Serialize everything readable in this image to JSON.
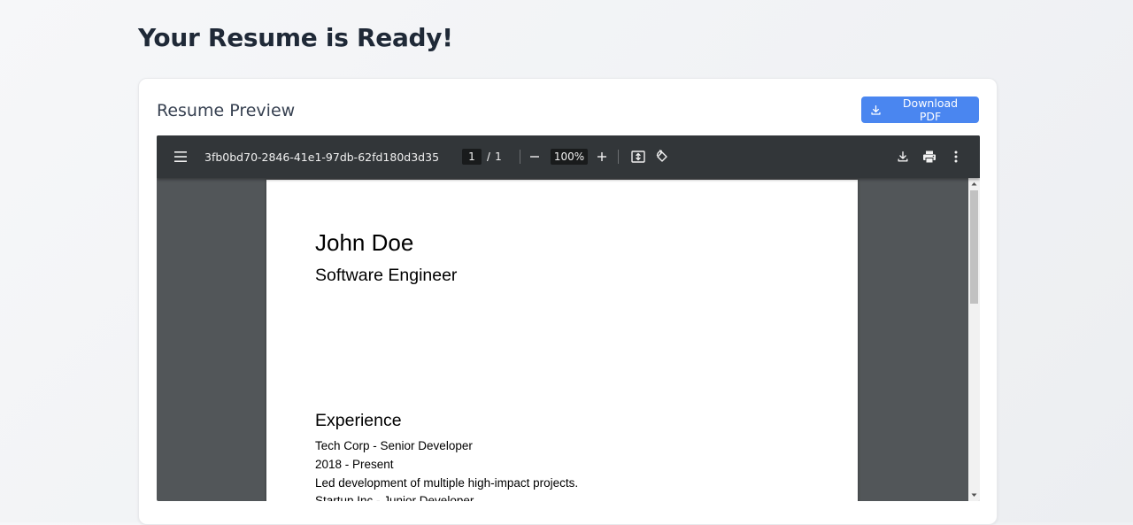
{
  "header": {
    "title": "Your Resume is Ready!"
  },
  "card": {
    "title": "Resume Preview",
    "download_button_label": "Download PDF"
  },
  "viewer": {
    "toolbar": {
      "document_title": "3fb0bd70-2846-41e1-97db-62fd180d3d35",
      "current_page": "1",
      "page_separator": "/",
      "total_pages": "1",
      "zoom": "100%"
    },
    "resume": {
      "name": "John Doe",
      "role": "Software Engineer",
      "experience_heading": "Experience",
      "lines": [
        "Tech Corp - Senior Developer",
        "2018 - Present",
        "Led development of multiple high-impact projects.",
        "Startup Inc - Junior Developer"
      ]
    }
  },
  "colors": {
    "accent": "#4a86f0",
    "viewer_toolbar": "#323639",
    "viewer_background": "#525659"
  },
  "icons": [
    "menu-icon",
    "zoom-out-icon",
    "zoom-in-icon",
    "fit-page-icon",
    "rotate-icon",
    "download-icon",
    "print-icon",
    "more-vert-icon"
  ]
}
